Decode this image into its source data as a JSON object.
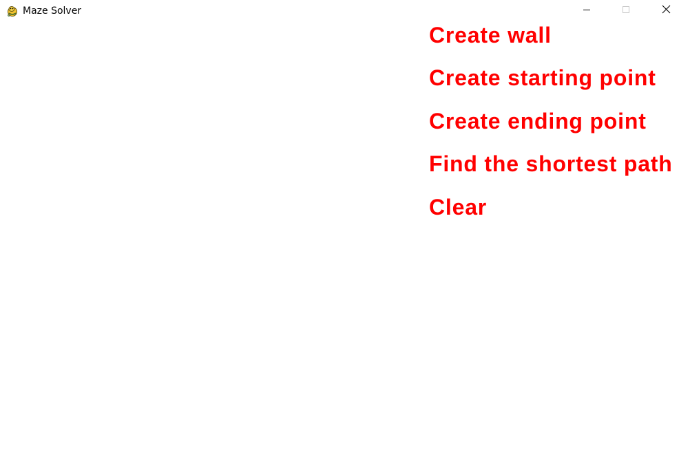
{
  "window": {
    "title": "Maze Solver",
    "app_icon": "pygame-snake-icon",
    "controls": {
      "minimize_icon": "minimize-icon",
      "maximize_icon": "maximize-icon",
      "close_icon": "close-icon"
    }
  },
  "menu": {
    "color": "#ff0000",
    "items": [
      {
        "label": "Create wall"
      },
      {
        "label": "Create starting point"
      },
      {
        "label": "Create ending point"
      },
      {
        "label": "Find the shortest path"
      },
      {
        "label": "Clear"
      }
    ]
  }
}
